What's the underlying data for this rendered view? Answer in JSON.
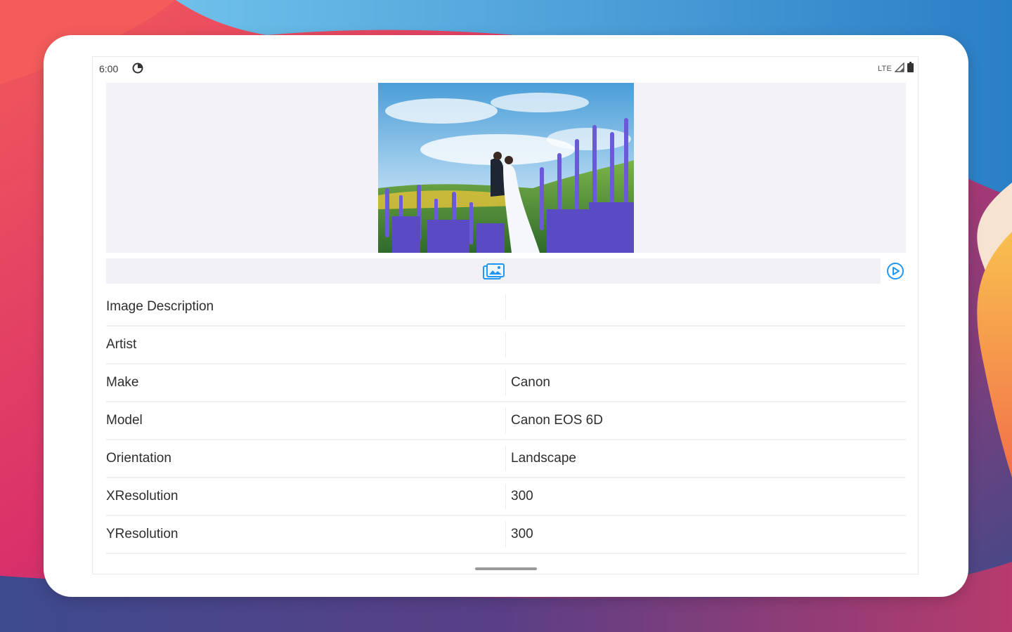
{
  "status_bar": {
    "time": "6:00",
    "data_icon": "data-saver-icon",
    "network": "LTE",
    "signal_icon": "cell-signal-icon",
    "battery_icon": "battery-icon"
  },
  "toolbar": {
    "gallery_icon": "gallery-icon",
    "play_icon": "play-circle-icon",
    "accent_color": "#2196f3"
  },
  "exif_rows": [
    {
      "key": "Image Description",
      "value": ""
    },
    {
      "key": "Artist",
      "value": ""
    },
    {
      "key": "Make",
      "value": "Canon"
    },
    {
      "key": "Model",
      "value": "Canon EOS 6D"
    },
    {
      "key": "Orientation",
      "value": "Landscape"
    },
    {
      "key": "XResolution",
      "value": "300"
    },
    {
      "key": "YResolution",
      "value": "300"
    }
  ]
}
